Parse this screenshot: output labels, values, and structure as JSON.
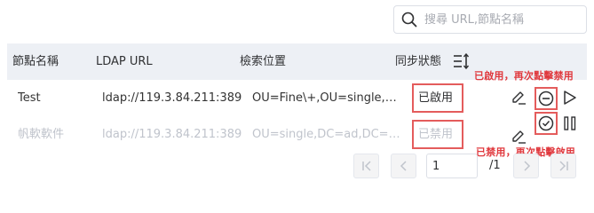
{
  "search": {
    "placeholder": "搜尋 URL,節點名稱"
  },
  "table": {
    "headers": {
      "node_name": "節點名稱",
      "ldap_url": "LDAP URL",
      "search_base": "檢索位置",
      "sync_status": "同步狀態"
    },
    "rows": [
      {
        "name": "Test",
        "url": "ldap://119.3.84.211:389",
        "base": "OU=Fine\\+,OU=single,DC=ad,DC=com",
        "status": "已啟用"
      },
      {
        "name": "帆軟軟件",
        "url": "ldap://119.3.84.211:389",
        "base": "OU=single,DC=ad,DC=com",
        "status": "已禁用"
      }
    ]
  },
  "annotations": {
    "row1": "已啟用，再次點擊禁用",
    "row2": "已禁用，再次點擊啟用"
  },
  "pagination": {
    "current": "1",
    "total": "/1"
  },
  "colors": {
    "highlight": "#e45c5c",
    "annotation": "#e0393e",
    "header_bg": "#edf0f5"
  },
  "icons": [
    "search-icon",
    "sort-icon",
    "edit-icon",
    "disable-icon",
    "play-icon",
    "enable-icon",
    "pause-icon",
    "first-page-icon",
    "prev-page-icon",
    "next-page-icon",
    "last-page-icon"
  ]
}
